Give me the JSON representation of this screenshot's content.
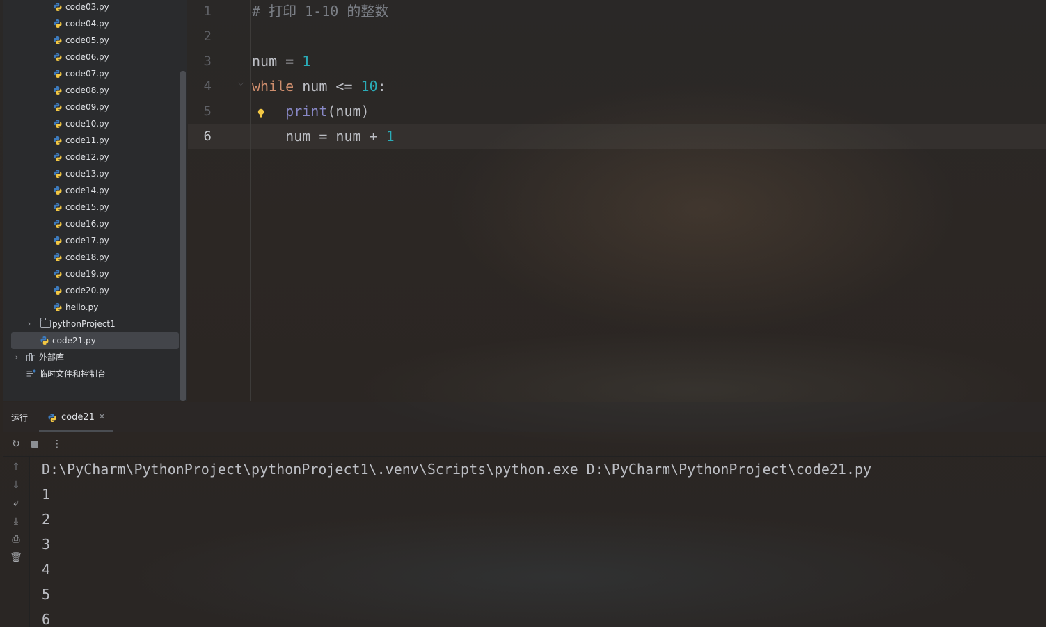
{
  "sidebar": {
    "files": [
      "code03.py",
      "code04.py",
      "code05.py",
      "code06.py",
      "code07.py",
      "code08.py",
      "code09.py",
      "code10.py",
      "code11.py",
      "code12.py",
      "code13.py",
      "code14.py",
      "code15.py",
      "code16.py",
      "code17.py",
      "code18.py",
      "code19.py",
      "code20.py",
      "hello.py"
    ],
    "folder": "pythonProject1",
    "selected_file": "code21.py",
    "external_libraries": "外部库",
    "scratches": "临时文件和控制台"
  },
  "editor": {
    "line_numbers": [
      "1",
      "2",
      "3",
      "4",
      "5",
      "6"
    ],
    "current_line": 6,
    "lines": [
      [
        {
          "t": "comment",
          "v": "# 打印 1-10 的整数"
        }
      ],
      [],
      [
        {
          "t": "plain",
          "v": "num = "
        },
        {
          "t": "num",
          "v": "1"
        }
      ],
      [
        {
          "t": "kw",
          "v": "while"
        },
        {
          "t": "plain",
          "v": " num <= "
        },
        {
          "t": "num",
          "v": "10"
        },
        {
          "t": "plain",
          "v": ":"
        }
      ],
      [
        {
          "t": "plain",
          "v": "    "
        },
        {
          "t": "builtin",
          "v": "print"
        },
        {
          "t": "plain",
          "v": "(num)"
        }
      ],
      [
        {
          "t": "plain",
          "v": "    num = num + "
        },
        {
          "t": "num",
          "v": "1"
        }
      ]
    ]
  },
  "run": {
    "title": "运行",
    "tab_label": "code21",
    "tab_close": "×",
    "console": [
      "D:\\PyCharm\\PythonProject\\pythonProject1\\.venv\\Scripts\\python.exe D:\\PyCharm\\PythonProject\\code21.py",
      "1",
      "2",
      "3",
      "4",
      "5",
      "6"
    ]
  },
  "icons": {
    "file": "python-file-icon",
    "rerun": "rerun-icon",
    "stop": "stop-icon",
    "more": "more-vertical-icon"
  },
  "colors": {
    "keyword": "#cf8e6d",
    "number": "#2aacb8",
    "builtin": "#8888c6",
    "comment": "#7a7e85",
    "python_blue": "#3d7bbd",
    "python_yellow": "#f2c744"
  }
}
